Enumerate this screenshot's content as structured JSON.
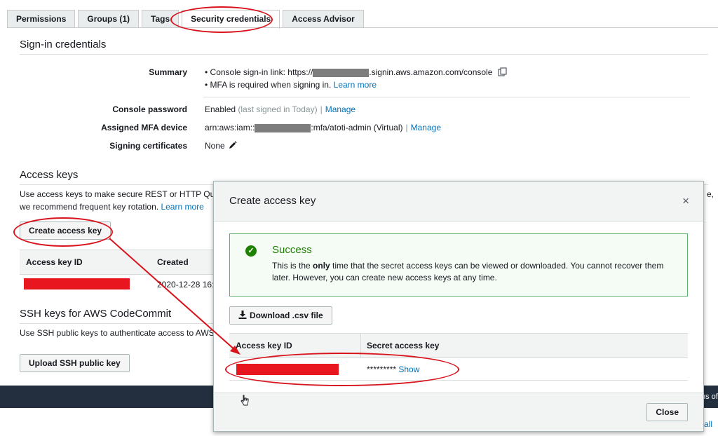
{
  "tabs": [
    {
      "label": "Permissions"
    },
    {
      "label": "Groups (1)"
    },
    {
      "label": "Tags"
    },
    {
      "label": "Security credentials"
    },
    {
      "label": "Access Advisor"
    }
  ],
  "signin": {
    "title": "Sign-in credentials",
    "summary_label": "Summary",
    "console_link_prefix": "Console sign-in link: https://",
    "console_link_suffix": ".signin.aws.amazon.com/console",
    "mfa_note": "MFA is required when signing in.",
    "learn_more": "Learn more",
    "console_password_label": "Console password",
    "console_password_value": "Enabled",
    "console_password_note": "(last signed in Today)",
    "manage": "Manage",
    "mfa_device_label": "Assigned MFA device",
    "mfa_device_prefix": "arn:aws:iam::",
    "mfa_device_suffix": ":mfa/atoti-admin (Virtual)",
    "signing_cert_label": "Signing certificates",
    "signing_cert_value": "None"
  },
  "access_keys": {
    "title": "Access keys",
    "desc_line1": "Use access keys to make secure REST or HTTP Que",
    "desc_line1_tail": "e,",
    "desc_line2": "we recommend frequent key rotation.",
    "learn_more": "Learn more",
    "create_button": "Create access key",
    "col_id": "Access key ID",
    "col_created": "Created",
    "row_created": "2020-12-28 16:"
  },
  "ssh": {
    "title": "SSH keys for AWS CodeCommit",
    "desc": "Use SSH public keys to authenticate access to AWS",
    "upload_button": "Upload SSH public key"
  },
  "darkbar_tail": "ns of",
  "bottom_tail": "all",
  "modal": {
    "title": "Create access key",
    "close_symbol": "×",
    "alert_title": "Success",
    "alert_text_before": "This is the ",
    "alert_text_bold": "only",
    "alert_text_after": " time that the secret access keys can be viewed or downloaded. You cannot recover them later. However, you can create new access keys at any time.",
    "download_button": "Download .csv file",
    "col_id": "Access key ID",
    "col_secret": "Secret access key",
    "secret_mask": "*********",
    "show": "Show",
    "close_button": "Close"
  },
  "colors": {
    "link": "#0073bb",
    "success": "#1d8102",
    "annotation_red": "#d8131c",
    "redaction_red": "#e8171f"
  }
}
